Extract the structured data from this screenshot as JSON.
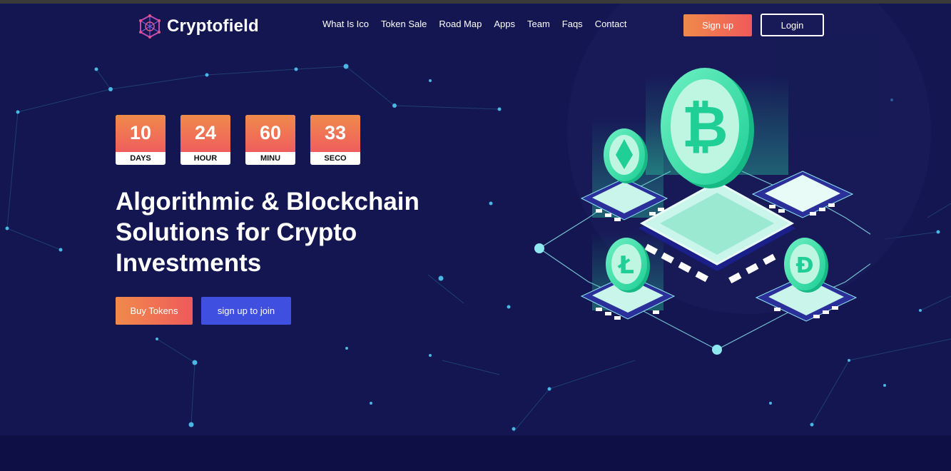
{
  "brand": {
    "name": "Cryptofield",
    "logo_icon": "network-globe-icon"
  },
  "nav": {
    "items": [
      "What Is Ico",
      "Token Sale",
      "Road Map",
      "Apps",
      "Team",
      "Faqs",
      "Contact"
    ]
  },
  "auth": {
    "signup_label": "Sign up",
    "login_label": "Login"
  },
  "countdown": [
    {
      "value": "10",
      "label": "DAYS"
    },
    {
      "value": "24",
      "label": "HOUR"
    },
    {
      "value": "60",
      "label": "MINU"
    },
    {
      "value": "33",
      "label": "SECO"
    }
  ],
  "hero": {
    "headline_line1": "Algorithmic & Blockchain",
    "headline_line2": "Solutions for Crypto",
    "headline_line3": "Investments",
    "buy_label": "Buy Tokens",
    "join_label": "sign up to join"
  },
  "illustration": {
    "icons": [
      "bitcoin-coin-icon",
      "ethereum-coin-icon",
      "litecoin-coin-icon",
      "dash-coin-icon",
      "cpu-chip-icon"
    ]
  },
  "colors": {
    "background": "#131650",
    "accent_gradient_start": "#f08a4b",
    "accent_gradient_end": "#ef5a5a",
    "secondary_button": "#3f4fdf",
    "coin_green": "#2fe3a8"
  }
}
